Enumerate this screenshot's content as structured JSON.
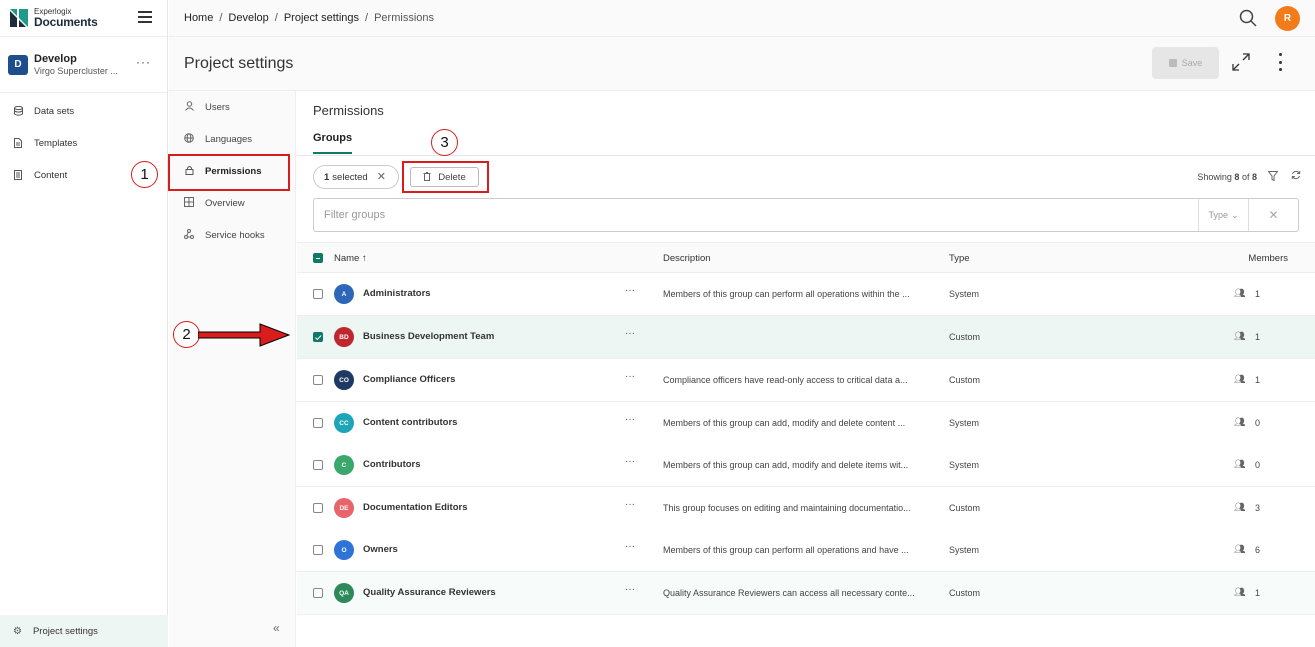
{
  "app": {
    "logo_line1": "Experlogix",
    "logo_line2": "Documents"
  },
  "project": {
    "avatar": "D",
    "name": "Develop",
    "subtitle": "Virgo Supercluster ...",
    "more": "···"
  },
  "sidebar": {
    "items": [
      {
        "label": "Data sets",
        "icon": "database-icon"
      },
      {
        "label": "Templates",
        "icon": "document-icon"
      },
      {
        "label": "Content",
        "icon": "content-icon"
      }
    ],
    "bottom_label": "Project settings"
  },
  "breadcrumb": {
    "home": "Home",
    "develop": "Develop",
    "settings": "Project settings",
    "current": "Permissions",
    "sep": "/"
  },
  "user": {
    "initial": "R"
  },
  "header": {
    "title": "Project settings",
    "save_label": "Save"
  },
  "settings_nav": {
    "items": [
      {
        "label": "Users"
      },
      {
        "label": "Languages"
      },
      {
        "label": "Permissions"
      },
      {
        "label": "Overview"
      },
      {
        "label": "Service hooks"
      }
    ],
    "active": "Permissions"
  },
  "main": {
    "title": "Permissions",
    "tab": "Groups",
    "selected_count": "1",
    "selected_label": "selected",
    "delete_label": "Delete",
    "showing_prefix": "Showing",
    "showing_count": "8",
    "showing_of": "of",
    "showing_total": "8",
    "filter_placeholder": "Filter groups",
    "type_filter": "Type"
  },
  "table": {
    "columns": {
      "name": "Name ↑",
      "description": "Description",
      "type": "Type",
      "members": "Members"
    },
    "rows": [
      {
        "initials": "A",
        "color": "#2e67b8",
        "name": "Administrators",
        "description": "Members of this group can perform all operations within the ...",
        "type": "System",
        "members": "1",
        "checked": false
      },
      {
        "initials": "BD",
        "color": "#c0262d",
        "name": "Business Development Team",
        "description": "",
        "type": "Custom",
        "members": "1",
        "checked": true
      },
      {
        "initials": "CO",
        "color": "#1d3a64",
        "name": "Compliance Officers",
        "description": "Compliance officers have read-only access to critical data a...",
        "type": "Custom",
        "members": "1",
        "checked": false
      },
      {
        "initials": "CC",
        "color": "#1da6b8",
        "name": "Content contributors",
        "description": "Members of this group can add, modify and delete content ...",
        "type": "System",
        "members": "0",
        "checked": false
      },
      {
        "initials": "C",
        "color": "#3aa86b",
        "name": "Contributors",
        "description": "Members of this group can add, modify and delete items wit...",
        "type": "System",
        "members": "0",
        "checked": false
      },
      {
        "initials": "DE",
        "color": "#e8646a",
        "name": "Documentation Editors",
        "description": "This group focuses on editing and maintaining documentatio...",
        "type": "Custom",
        "members": "3",
        "checked": false
      },
      {
        "initials": "O",
        "color": "#2e73d6",
        "name": "Owners",
        "description": "Members of this group can perform all operations and have ...",
        "type": "System",
        "members": "6",
        "checked": false
      },
      {
        "initials": "QA",
        "color": "#2c8a5a",
        "name": "Quality Assurance Reviewers",
        "description": "Quality Assurance Reviewers can access all necessary conte...",
        "type": "Custom",
        "members": "1",
        "checked": false
      }
    ]
  },
  "annotations": {
    "n1": "1",
    "n2": "2",
    "n3": "3"
  }
}
